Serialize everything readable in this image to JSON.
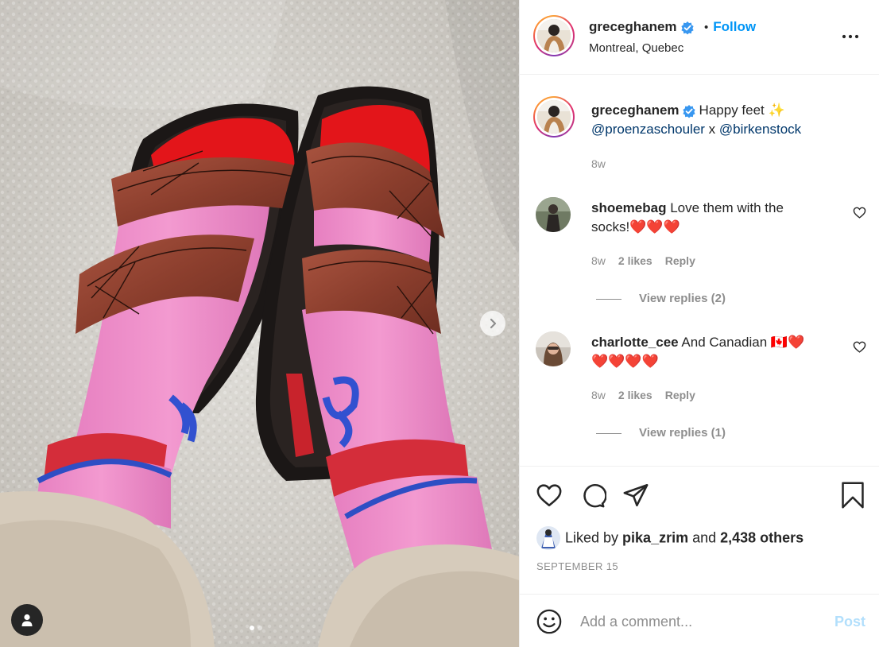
{
  "post": {
    "author": "greceghanem",
    "location": "Montreal, Quebec",
    "follow_label": "Follow",
    "separator": "•",
    "caption_text": "Happy feet ✨",
    "mention_1": "@proenzaschouler",
    "caption_join": " x ",
    "mention_2": "@birkenstock",
    "caption_age": "8w",
    "likes_prefix": "Liked by ",
    "likes_user": "pika_zrim",
    "likes_mid": " and ",
    "likes_count": "2,438 others",
    "date": "SEPTEMBER 15",
    "carousel_index": 1,
    "carousel_total": 2
  },
  "comments": [
    {
      "user": "shoemebag",
      "text_line1": "Love them with the",
      "text_line2": "socks!❤️❤️❤️",
      "age": "8w",
      "likes": "2 likes",
      "reply": "Reply",
      "view_replies": "View replies (2)"
    },
    {
      "user": "charlotte_cee",
      "text_line1": "And Canadian 🇨🇦❤️",
      "text_line2": "❤️❤️❤️❤️",
      "age": "8w",
      "likes": "2 likes",
      "reply": "Reply",
      "view_replies": "View replies (1)"
    }
  ],
  "add_comment": {
    "placeholder": "Add a comment...",
    "post_label": "Post"
  },
  "icons": {
    "more": "more-horizontal-icon",
    "verified": "verified-badge-icon",
    "like": "heart-icon",
    "comment": "comment-bubble-icon",
    "share": "paper-plane-icon",
    "save": "bookmark-icon",
    "emoji": "emoji-smile-icon",
    "next": "chevron-right-icon",
    "user_tag": "user-tag-icon"
  },
  "colors": {
    "link_blue": "#0095f6",
    "mention_navy": "#00376b",
    "muted": "#8e8e8e",
    "post_disabled": "#b2dffc",
    "verified_blue": "#3897f0"
  }
}
